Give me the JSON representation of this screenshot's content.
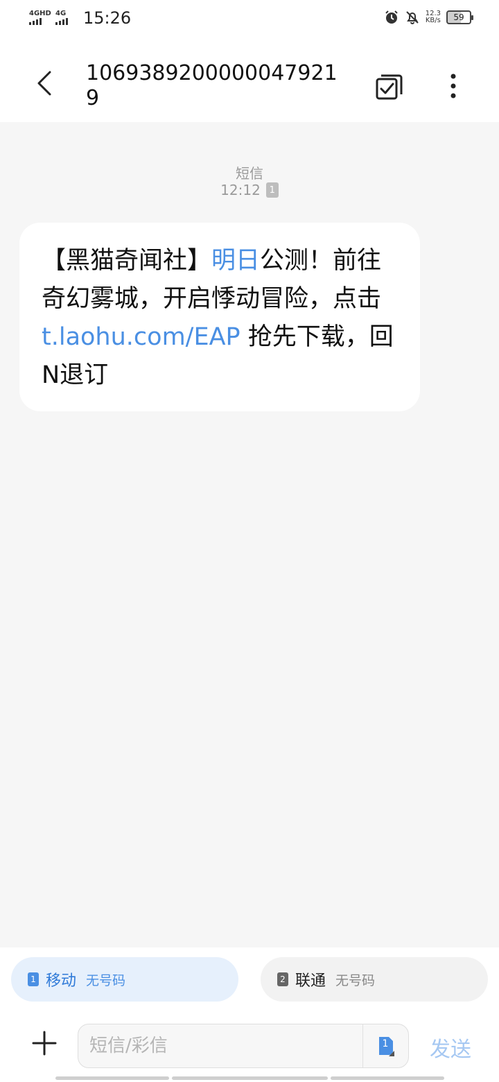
{
  "status_bar": {
    "sim1_label": "4GHD",
    "sim2_label": "4G",
    "time": "15:26",
    "speed_value": "12.3",
    "speed_unit": "KB/s",
    "battery": "59",
    "battery_level": 0.59
  },
  "header": {
    "title": "10693892000000479219"
  },
  "conversation": {
    "label": "短信",
    "time": "12:12",
    "sim_badge": "1"
  },
  "message": {
    "part1": "【黑猫奇闻社】",
    "link1": "明日",
    "part2": "公测！前往奇幻雾城，开启悸动冒险，点击 ",
    "link2": "t.laohu.com/EAP",
    "part3": " 抢先下载，回N退订"
  },
  "sim_selector": {
    "sim1": {
      "badge": "1",
      "name": "移动",
      "number": "无号码",
      "selected": true
    },
    "sim2": {
      "badge": "2",
      "name": "联通",
      "number": "无号码",
      "selected": false
    }
  },
  "composer": {
    "placeholder": "短信/彩信",
    "sim_badge": "1",
    "send_label": "发送"
  },
  "colors": {
    "accent": "#4a8fe3",
    "send_disabled": "#a6c8f2",
    "bubble": "#ffffff",
    "background": "#f6f6f6"
  }
}
